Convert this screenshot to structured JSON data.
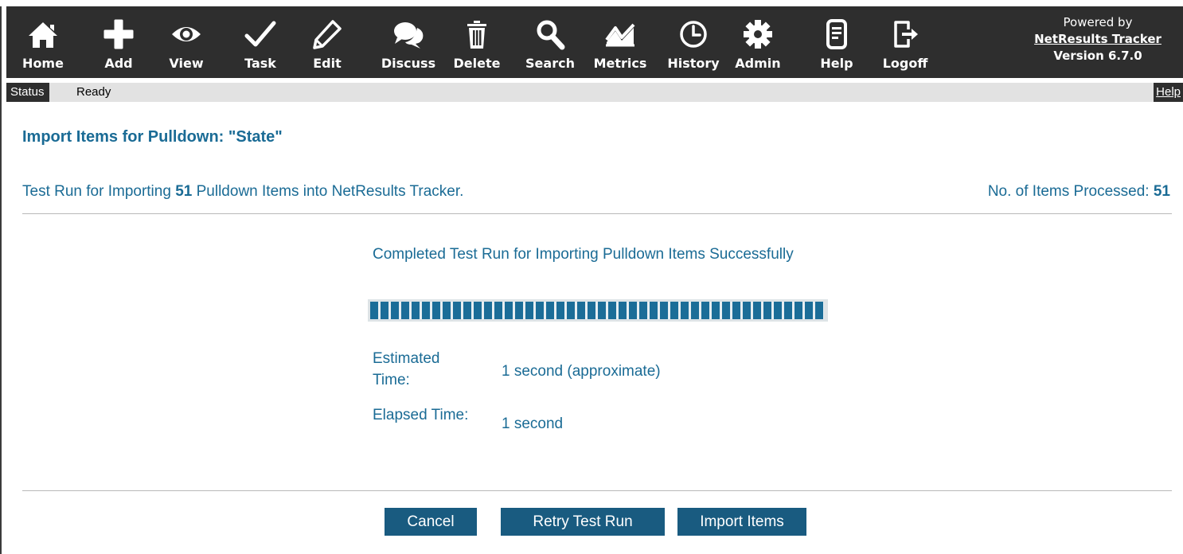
{
  "toolbar": {
    "items": [
      {
        "label": "Home",
        "icon": "home-icon"
      },
      {
        "label": "Add",
        "icon": "plus-icon"
      },
      {
        "label": "View",
        "icon": "eye-icon"
      },
      {
        "label": "Task",
        "icon": "checkmark-icon"
      },
      {
        "label": "Edit",
        "icon": "pencil-icon"
      },
      {
        "label": "Discuss",
        "icon": "speech-bubbles-icon"
      },
      {
        "label": "Delete",
        "icon": "trash-icon"
      },
      {
        "label": "Search",
        "icon": "magnifier-icon"
      },
      {
        "label": "Metrics",
        "icon": "line-chart-icon"
      },
      {
        "label": "History",
        "icon": "clock-icon"
      },
      {
        "label": "Admin",
        "icon": "gear-icon"
      },
      {
        "label": "Help",
        "icon": "document-icon"
      },
      {
        "label": "Logoff",
        "icon": "logoff-icon"
      }
    ],
    "powered_by": "Powered by",
    "product_link": "NetResults Tracker",
    "version": "Version 6.7.0"
  },
  "status": {
    "label": "Status",
    "value": "Ready",
    "help": "Help"
  },
  "page": {
    "title": "Import Items for Pulldown: \"State\"",
    "run_prefix": "Test Run for Importing ",
    "run_count": "51",
    "run_suffix": " Pulldown Items into NetResults Tracker.",
    "processed_label": "No. of Items Processed: ",
    "processed_count": "51"
  },
  "progress": {
    "message": "Completed Test Run for Importing Pulldown Items Successfully",
    "percent": 100,
    "estimated_label": "Estimated Time:",
    "estimated_value": "1 second (approximate)",
    "elapsed_label": "Elapsed Time:",
    "elapsed_value": "1 second"
  },
  "buttons": {
    "cancel": "Cancel",
    "retry": "Retry Test Run",
    "import": "Import Items"
  },
  "colors": {
    "toolbar_bg": "#2e2e2e",
    "accent_text": "#1a6b95",
    "button_bg": "#195b80",
    "progress_fill": "#1b6d98"
  }
}
